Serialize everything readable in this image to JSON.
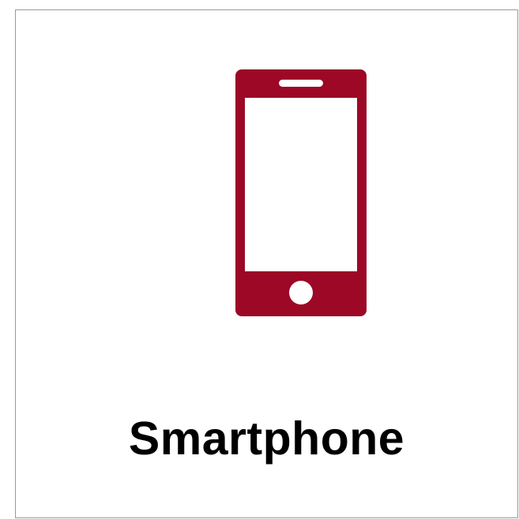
{
  "card": {
    "icon": "smartphone-icon",
    "label": "Smartphone",
    "icon_color": "#9c0826",
    "border_color": "#9a9a9a"
  }
}
